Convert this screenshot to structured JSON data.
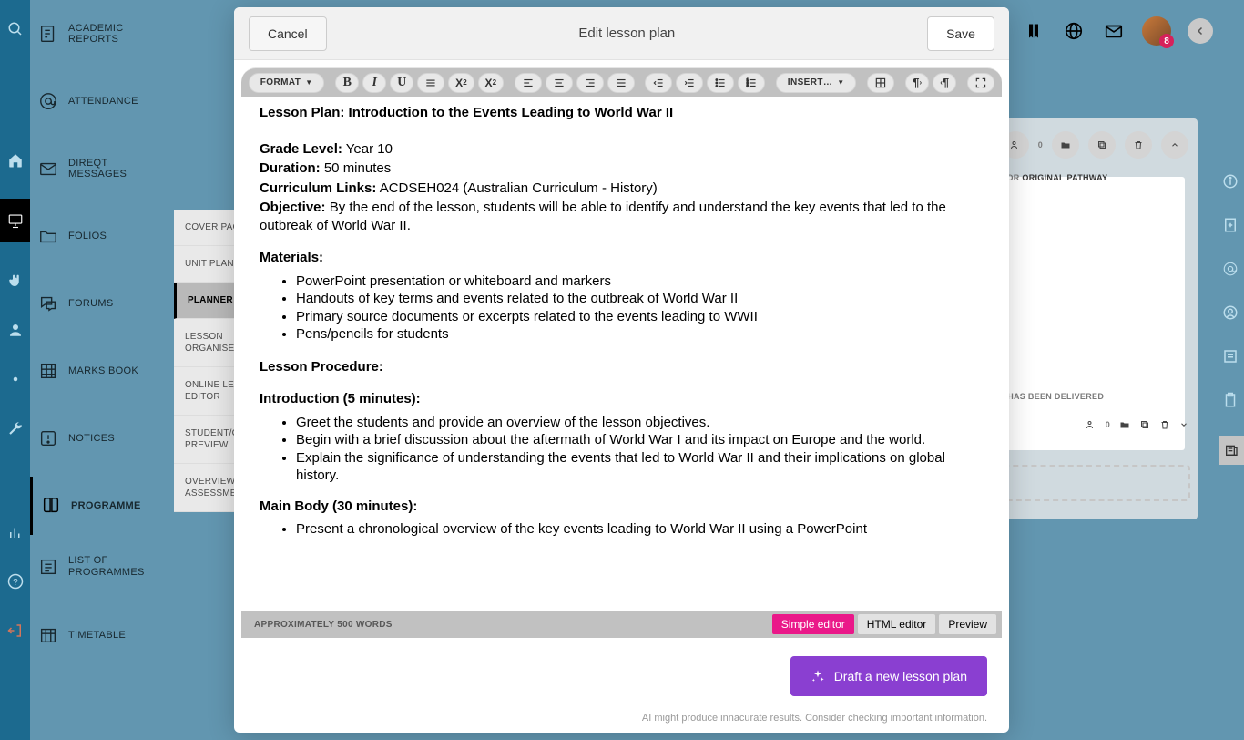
{
  "modal": {
    "title": "Edit lesson plan",
    "cancel": "Cancel",
    "save": "Save"
  },
  "toolbar": {
    "format": "FORMAT",
    "insert": "INSERT…"
  },
  "lesson": {
    "title": "Lesson Plan: Introduction to the Events Leading to World War II",
    "grade_label": "Grade Level:",
    "grade_value": " Year 10",
    "duration_label": "Duration:",
    "duration_value": " 50 minutes",
    "curriculum_label": "Curriculum Links:",
    "curriculum_value": " ACDSEH024 (Australian Curriculum - History)",
    "objective_label": "Objective:",
    "objective_value": " By the end of the lesson, students will be able to identify and understand the key events that led to the outbreak of World War II.",
    "materials_label": "Materials:",
    "materials": [
      "PowerPoint presentation or whiteboard and markers",
      "Handouts of key terms and events related to the outbreak of World War II",
      "Primary source documents or excerpts related to the events leading to WWII",
      "Pens/pencils for students"
    ],
    "procedure_label": "Lesson Procedure:",
    "intro_label": "Introduction (5 minutes):",
    "intro_items": [
      "Greet the students and provide an overview of the lesson objectives.",
      "Begin with a brief discussion about the aftermath of World War I and its impact on Europe and the world.",
      "Explain the significance of understanding the events that led to World War II and their implications on global history."
    ],
    "mainbody_label": "Main Body (30 minutes):",
    "mainbody_items": [
      "Present a chronological overview of the key events leading to World War II using a PowerPoint"
    ]
  },
  "footer": {
    "wordcount": "APPROXIMATELY 500 WORDS",
    "tabs": {
      "simple": "Simple editor",
      "html": "HTML editor",
      "preview": "Preview"
    },
    "draft": "Draft a new lesson plan",
    "disclaimer": "AI might produce innacurate results. Consider checking important information."
  },
  "nav": {
    "items": [
      "ACADEMIC REPORTS",
      "ATTENDANCE",
      "DIREQT MESSAGES",
      "FOLIOS",
      "FORUMS",
      "MARKS BOOK",
      "NOTICES",
      "PROGRAMME",
      "LIST OF PROGRAMMES",
      "TIMETABLE"
    ]
  },
  "subnav": {
    "items": [
      "COVER PAGE",
      "UNIT PLAN",
      "PLANNER",
      "LESSON ORGANISER",
      "ONLINE LESSON EDITOR",
      "STUDENT/GUARDIAN PREVIEW",
      "OVERVIEW OF ASSESSMENTS"
    ]
  },
  "bgpanel": {
    "heading": "ORIGINAL PATHWAY",
    "heading_prefix": "…RK FOR ",
    "zero1": "0",
    "zero2": "0",
    "delivered": "…ON HAS BEEN DELIVERED"
  },
  "topbar": {
    "badge": "8"
  }
}
